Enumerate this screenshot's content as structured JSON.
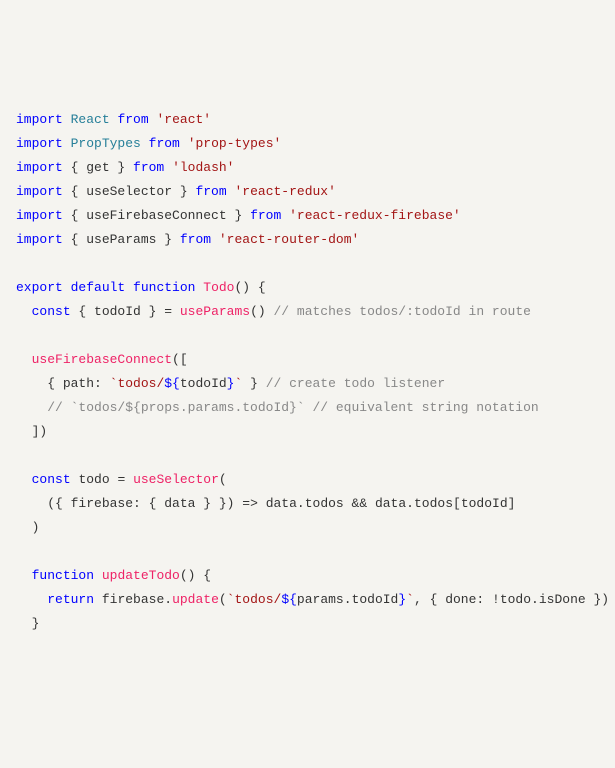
{
  "code": {
    "l1": {
      "import": "import",
      "React": "React",
      "from": "from",
      "str": "'react'"
    },
    "l2": {
      "import": "import",
      "PropTypes": "PropTypes",
      "from": "from",
      "str": "'prop-types'"
    },
    "l3": {
      "import": "import",
      "name": "get",
      "from": "from",
      "str": "'lodash'"
    },
    "l4": {
      "import": "import",
      "name": "useSelector",
      "from": "from",
      "str": "'react-redux'"
    },
    "l5": {
      "import": "import",
      "name": "useFirebaseConnect",
      "from": "from",
      "str": "'react-redux-firebase'"
    },
    "l6": {
      "import": "import",
      "name": "useParams",
      "from": "from",
      "str": "'react-router-dom'"
    },
    "l8": {
      "export": "export",
      "default": "default",
      "function": "function",
      "Todo": "Todo"
    },
    "l9": {
      "const": "const",
      "todoId": "todoId",
      "useParams": "useParams",
      "cmt": "// matches todos/:todoId in route"
    },
    "l11": {
      "fn": "useFirebaseConnect"
    },
    "l12": {
      "path": "path",
      "tpl1": "`todos/",
      "todoId": "todoId",
      "tpl2": "`",
      "cmt": "// create todo listener"
    },
    "l13": {
      "cmt": "// `todos/${props.params.todoId}` // equivalent string notation"
    },
    "l16": {
      "const": "const",
      "todo": "todo",
      "useSelector": "useSelector"
    },
    "l17": {
      "firebase": "firebase",
      "data": "data",
      "todos": "todos",
      "todoId": "todoId"
    },
    "l20": {
      "function": "function",
      "updateTodo": "updateTodo"
    },
    "l21": {
      "return": "return",
      "firebase": "firebase",
      "update": "update",
      "tpl1": "`todos/",
      "params": "params",
      "todoId": "todoId",
      "tpl2": "`",
      "done": "done",
      "todo": "todo",
      "isDone": "isDone"
    }
  }
}
